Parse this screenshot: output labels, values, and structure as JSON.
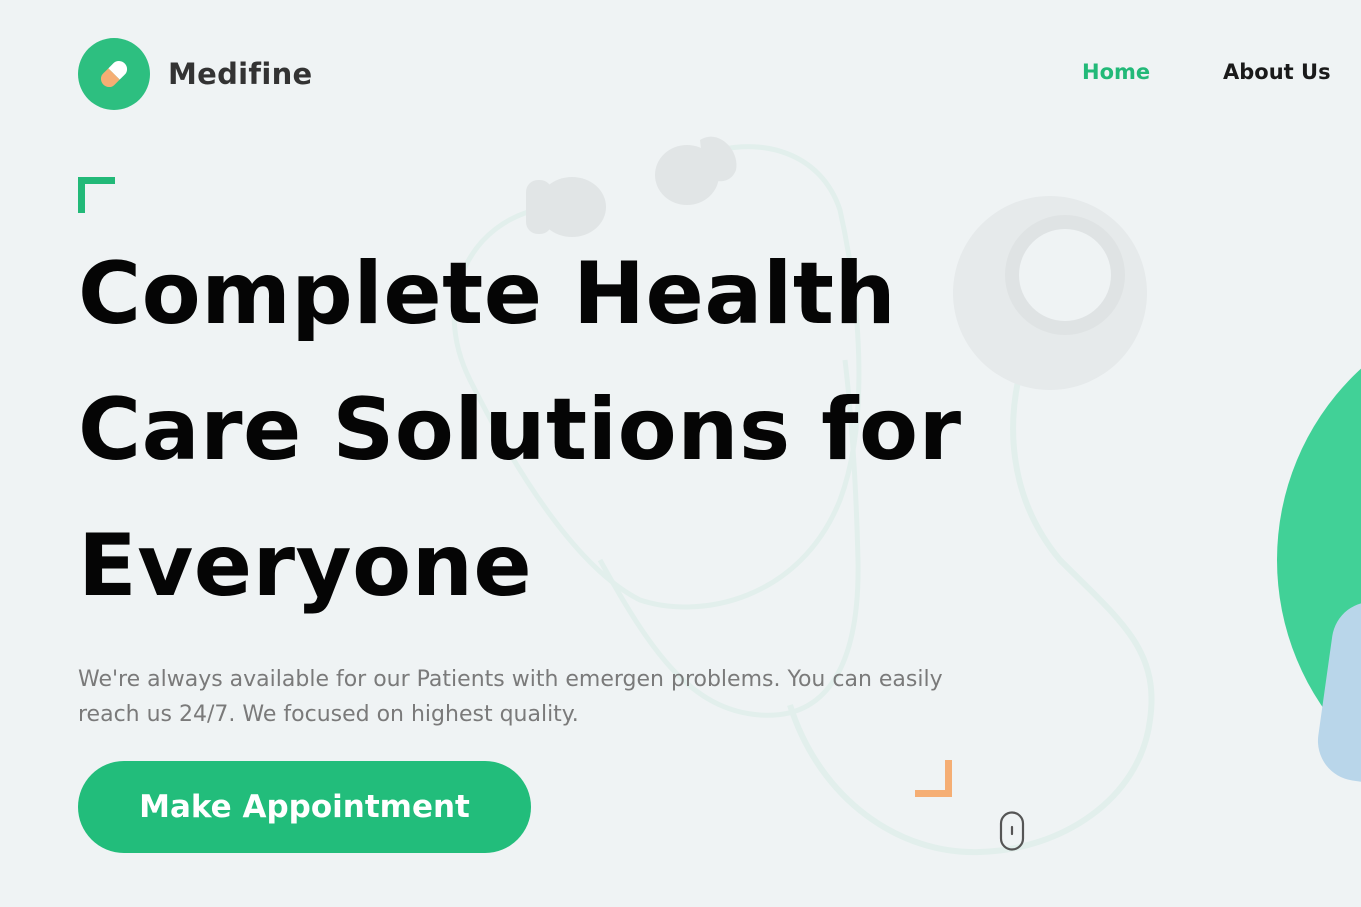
{
  "brand": {
    "name": "Medifine",
    "logo_icon": "pill-capsule-icon",
    "accent_color": "#22b978",
    "secondary_accent_color": "#f5ae74"
  },
  "nav": {
    "items": [
      {
        "label": "Home",
        "active": true
      },
      {
        "label": "About Us",
        "active": false
      }
    ]
  },
  "hero": {
    "title_lines": [
      "Complete Health",
      "Care Solutions for",
      "Everyone"
    ],
    "description": "We're always available for our Patients with emergen problems. You can easily reach us 24/7. We focused on highest quality.",
    "cta_label": "Make Appointment",
    "background_icon": "stethoscope-icon",
    "scroll_icon": "mouse-scroll-icon"
  }
}
